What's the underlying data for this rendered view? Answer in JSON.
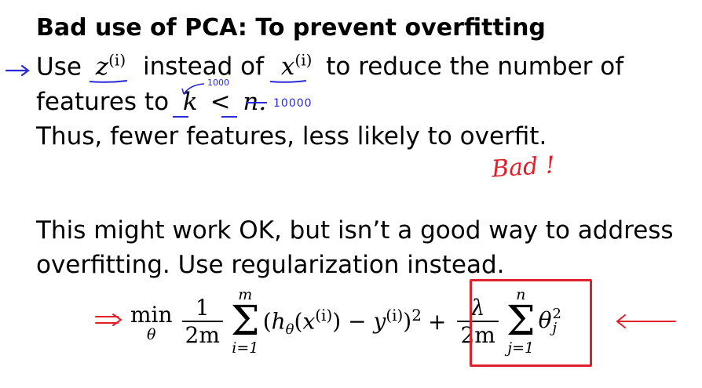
{
  "slide": {
    "title": "Bad use of PCA: To prevent overfitting",
    "line1_use": "Use",
    "z_var": "z",
    "sup_i": "(i)",
    "line1_instead_of": "instead of",
    "x_var": "x",
    "line1_rest": "to reduce the number of",
    "line2_features_to": "features to",
    "k_var": "k",
    "less_than": "<",
    "n_var": "n",
    "period": ".",
    "line3": "Thus, fewer features, less likely to overfit.",
    "line4": "This might work OK, but isn’t a good way to address",
    "line5": "overfitting. Use regularization instead."
  },
  "annotations": {
    "k_value": "1000",
    "n_value": "10000",
    "bad_label": "Bad !"
  },
  "formula": {
    "min": "min",
    "min_sub": "θ",
    "frac1_num": "1",
    "frac1_den": "2m",
    "sum1_top": "m",
    "sum1_bottom": "i=1",
    "sum_symbol": "Σ",
    "term1": "(h",
    "theta_sub": "θ",
    "term1b": "(x",
    "term1c": ") − y",
    "term1d": ")",
    "square": "2",
    "plus": "+",
    "frac2_num": "λ",
    "frac2_den": "2m",
    "sum2_top": "n",
    "sum2_bottom": "j=1",
    "theta": "θ",
    "theta_sup": "2",
    "theta_sub_j": "j"
  },
  "colors": {
    "blue_ink": "#2a2ad8",
    "red_ink": "#e0202a"
  }
}
